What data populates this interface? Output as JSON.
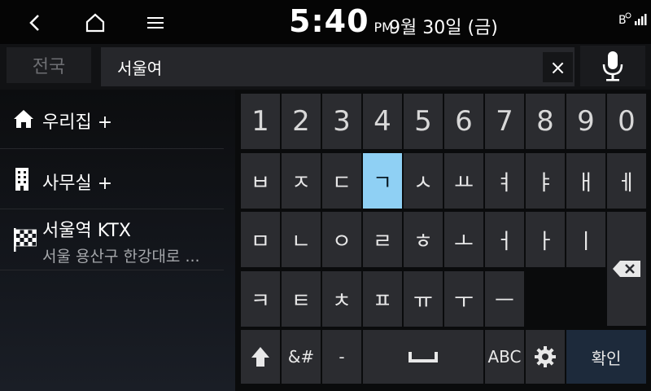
{
  "status_bar": {
    "time": "5:40",
    "ampm": "PM",
    "date": "9월 30일 (금)",
    "status_icons": [
      "bluetooth-icon",
      "signal-icon"
    ]
  },
  "nav": {
    "icons": [
      "back-icon",
      "home-icon",
      "menu-icon"
    ]
  },
  "search": {
    "region_label": "전국",
    "query": "서울여",
    "clear_label": "×",
    "mic_icon": "microphone-icon"
  },
  "favorites": [
    {
      "label": "우리집 +",
      "icon": "home-icon"
    },
    {
      "label": "사무실 +",
      "icon": "building-icon"
    }
  ],
  "result": {
    "title": "서울역 KTX",
    "address": "서울 용산구 한강대로 ...",
    "icon": "checkered-flag-icon"
  },
  "keyboard": {
    "numbers": [
      "1",
      "2",
      "3",
      "4",
      "5",
      "6",
      "7",
      "8",
      "9",
      "0"
    ],
    "row1": [
      "ㅂ",
      "ㅈ",
      "ㄷ",
      "ㄱ",
      "ㅅ",
      "ㅛ",
      "ㅕ",
      "ㅑ",
      "ㅐ",
      "ㅔ"
    ],
    "row2": [
      "ㅁ",
      "ㄴ",
      "ㅇ",
      "ㄹ",
      "ㅎ",
      "ㅗ",
      "ㅓ",
      "ㅏ",
      "ㅣ"
    ],
    "row3": [
      "ㅋ",
      "ㅌ",
      "ㅊ",
      "ㅍ",
      "ㅠ",
      "ㅜ",
      "ㅡ"
    ],
    "highlighted_key": "ㄱ",
    "symbols_label": "&#",
    "dash_label": "-",
    "abc_label": "ABC",
    "confirm_label": "확인",
    "highlight_color": "#8fd0f4"
  }
}
